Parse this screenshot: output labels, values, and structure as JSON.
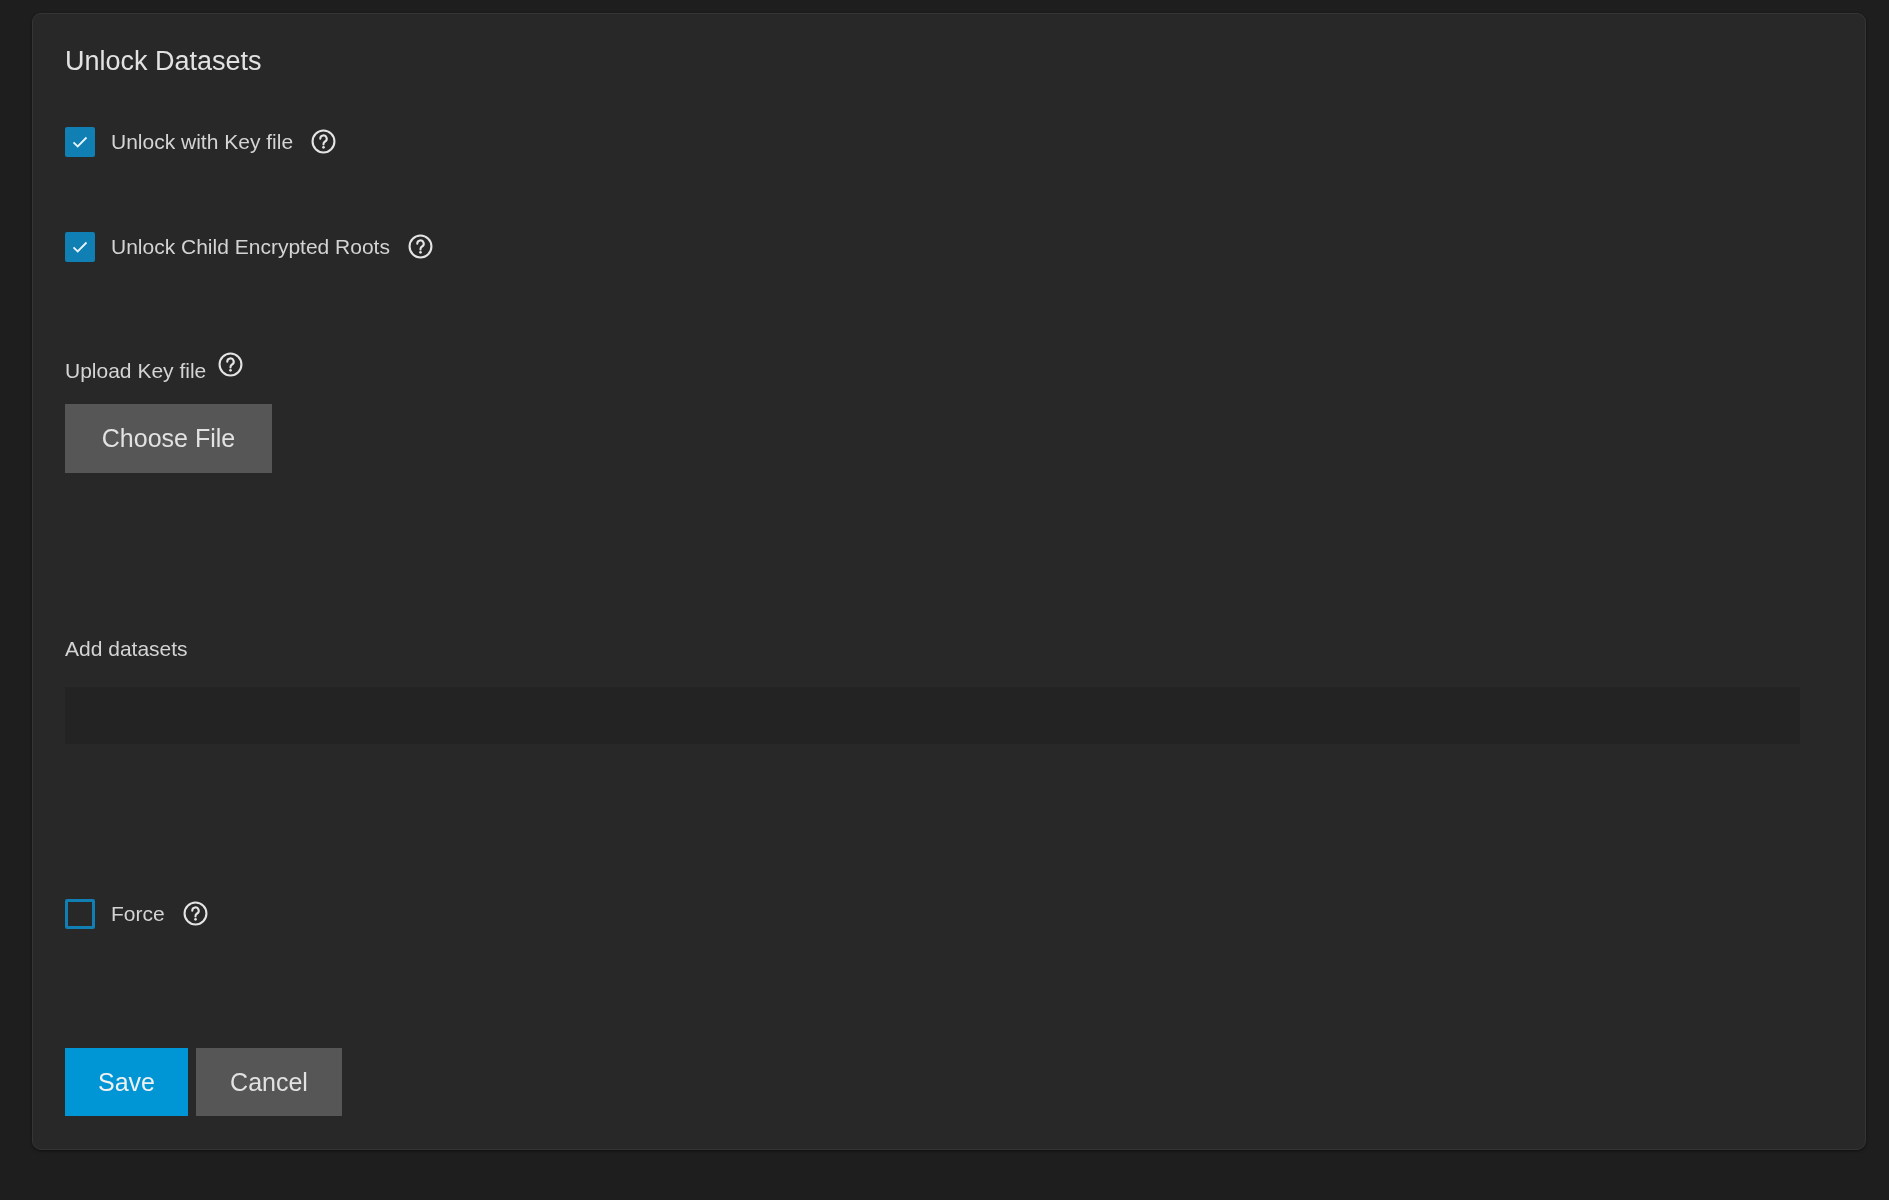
{
  "title": "Unlock Datasets",
  "checkboxes": [
    {
      "label": "Unlock with Key file",
      "checked": true
    },
    {
      "label": "Unlock Child Encrypted Roots",
      "checked": true
    }
  ],
  "upload": {
    "label": "Upload Key file",
    "button": "Choose File"
  },
  "datasets": {
    "label": "Add datasets"
  },
  "force": {
    "label": "Force",
    "checked": false
  },
  "buttons": [
    {
      "label": "Save",
      "kind": "primary"
    },
    {
      "label": "Cancel",
      "kind": "secondary"
    }
  ]
}
